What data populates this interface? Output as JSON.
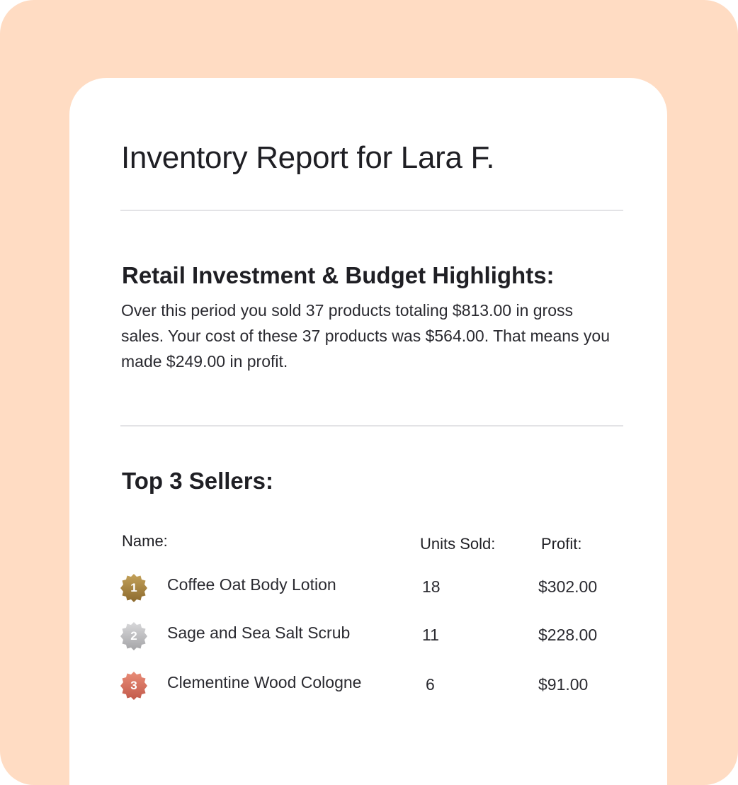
{
  "report": {
    "title": "Inventory Report for Lara F.",
    "highlights_heading": "Retail Investment & Budget Highlights:",
    "highlights_text": "Over this period you sold 37 products totaling $813.00 in gross sales. Your cost of these 37 products was $564.00. That means you made $249.00 in profit.",
    "sellers_heading": "Top 3 Sellers:"
  },
  "table": {
    "headers": {
      "name": "Name:",
      "units": "Units Sold:",
      "profit": "Profit:"
    },
    "rows": [
      {
        "rank": "1",
        "name": "Coffee Oat Body Lotion",
        "units": "18",
        "profit": "$302.00",
        "badge_icon": "gold-medal-icon",
        "badge_color": "#a8843f"
      },
      {
        "rank": "2",
        "name": "Sage and Sea Salt Scrub",
        "units": "11",
        "profit": "$228.00",
        "badge_icon": "silver-medal-icon",
        "badge_color": "#b9b9bb"
      },
      {
        "rank": "3",
        "name": "Clementine Wood Cologne",
        "units": "6",
        "profit": "$91.00",
        "badge_icon": "bronze-medal-icon",
        "badge_color": "#d4725e"
      }
    ]
  },
  "colors": {
    "background": "#ffdcc3",
    "card": "#ffffff",
    "divider": "#e3e3e6",
    "text": "#1f1f24"
  }
}
